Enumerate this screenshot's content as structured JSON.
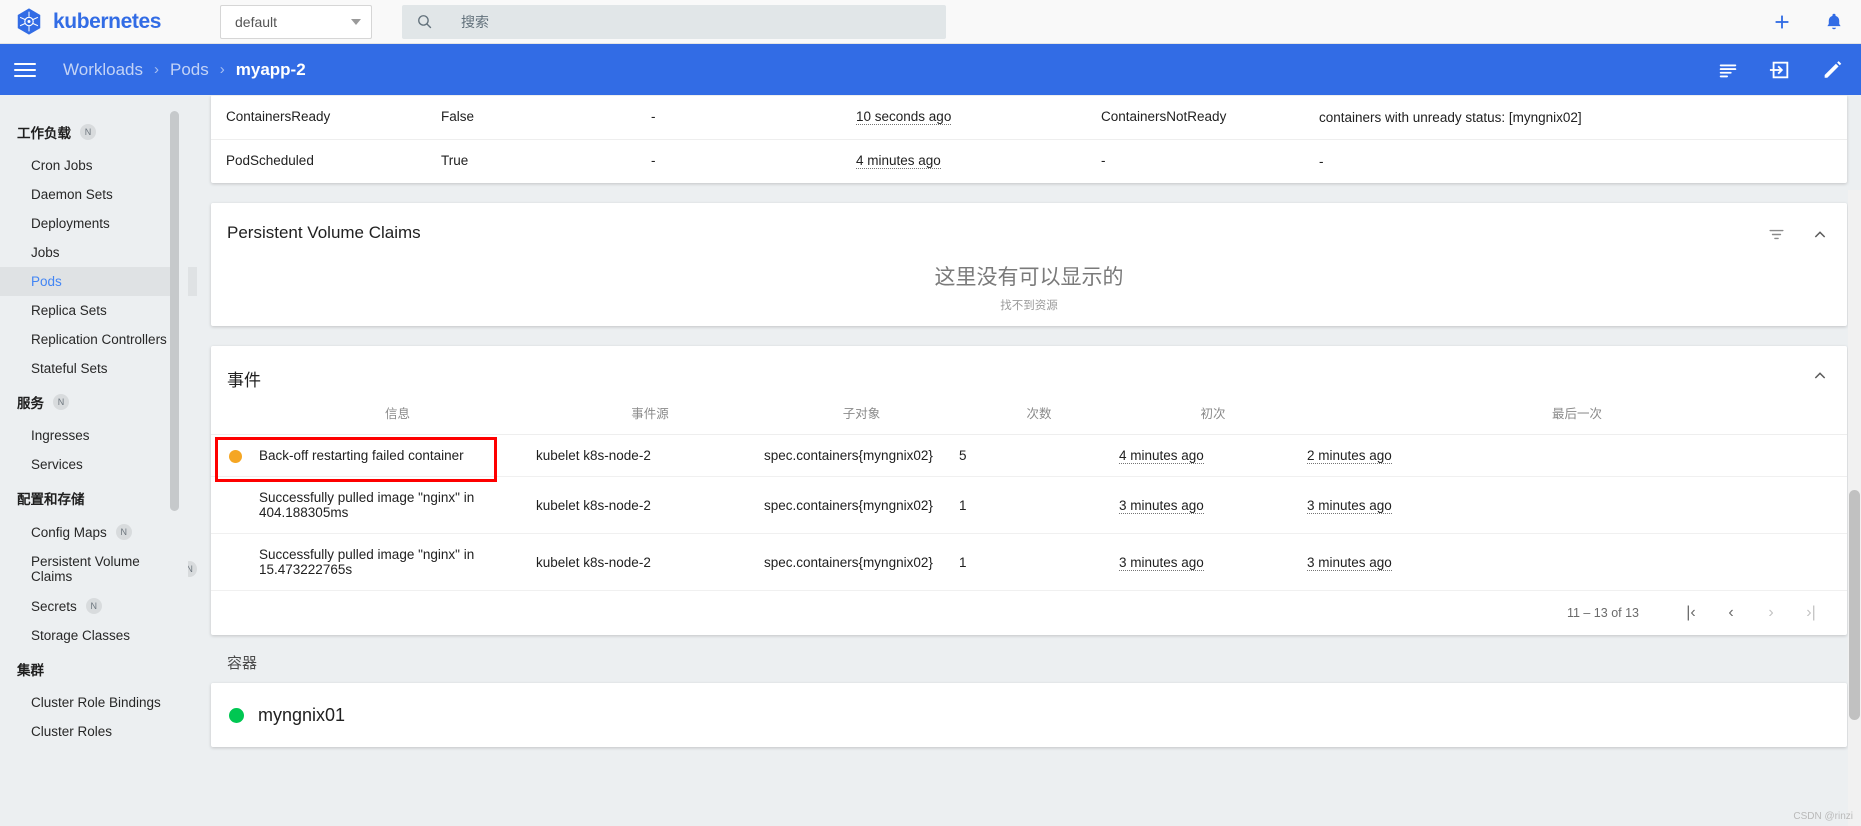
{
  "header": {
    "product_name": "kubernetes",
    "namespace_value": "default",
    "namespace_caret": "chevron-down-icon",
    "search_placeholder": "搜索",
    "add_label": "+",
    "icons": {
      "search": "search-icon",
      "add": "plus-icon",
      "notifications": "bell-icon"
    }
  },
  "breadcrumb": {
    "menu_icon": "hamburger-menu-icon",
    "items": [
      {
        "label": "Workloads",
        "active": false
      },
      {
        "label": "Pods",
        "active": false
      },
      {
        "label": "myapp-2",
        "active": true
      }
    ],
    "separator": "›",
    "actions": {
      "logs": "logs-icon",
      "exec": "exec-terminal-icon",
      "edit": "edit-pencil-icon"
    }
  },
  "sidebar": {
    "groups": [
      {
        "label": "工作负载",
        "badge": "N",
        "items": [
          {
            "label": "Cron Jobs",
            "selected": false,
            "badge": ""
          },
          {
            "label": "Daemon Sets",
            "selected": false,
            "badge": ""
          },
          {
            "label": "Deployments",
            "selected": false,
            "badge": ""
          },
          {
            "label": "Jobs",
            "selected": false,
            "badge": ""
          },
          {
            "label": "Pods",
            "selected": true,
            "badge": ""
          },
          {
            "label": "Replica Sets",
            "selected": false,
            "badge": ""
          },
          {
            "label": "Replication Controllers",
            "selected": false,
            "badge": ""
          },
          {
            "label": "Stateful Sets",
            "selected": false,
            "badge": ""
          }
        ]
      },
      {
        "label": "服务",
        "badge": "N",
        "items": [
          {
            "label": "Ingresses",
            "selected": false,
            "badge": ""
          },
          {
            "label": "Services",
            "selected": false,
            "badge": ""
          }
        ]
      },
      {
        "label": "配置和存储",
        "badge": "",
        "items": [
          {
            "label": "Config Maps",
            "selected": false,
            "badge": "N"
          },
          {
            "label": "Persistent Volume Claims",
            "selected": false,
            "badge": "N"
          },
          {
            "label": "Secrets",
            "selected": false,
            "badge": "N"
          },
          {
            "label": "Storage Classes",
            "selected": false,
            "badge": ""
          }
        ]
      },
      {
        "label": "集群",
        "badge": "",
        "items": [
          {
            "label": "Cluster Role Bindings",
            "selected": false,
            "badge": ""
          },
          {
            "label": "Cluster Roles",
            "selected": false,
            "badge": ""
          }
        ]
      }
    ]
  },
  "conditions": {
    "rows": [
      {
        "type": "ContainersReady",
        "status": "False",
        "last_probe": "-",
        "last_transition": "10 seconds ago",
        "reason": "ContainersNotReady",
        "message": "containers with unready status: [myngnix02]"
      },
      {
        "type": "PodScheduled",
        "status": "True",
        "last_probe": "-",
        "last_transition": "4 minutes ago",
        "reason": "-",
        "message": "-"
      }
    ],
    "clipped_above": "[myngnix02]"
  },
  "pvc": {
    "title": "Persistent Volume Claims",
    "filter_icon": "filter-icon",
    "collapse_icon": "chevron-up-icon",
    "empty_title": "这里没有可以显示的",
    "empty_subtitle": "找不到资源"
  },
  "events": {
    "title": "事件",
    "collapse_icon": "chevron-up-icon",
    "columns": [
      "信息",
      "事件源",
      "子对象",
      "次数",
      "初次",
      "最后一次"
    ],
    "rows": [
      {
        "status_dot": "#f5a623",
        "message": "Back-off restarting failed container",
        "source": "kubelet k8s-node-2",
        "subobject": "spec.containers{myngnix02}",
        "count": "5",
        "first_seen": "4 minutes ago",
        "last_seen": "2 minutes ago",
        "highlighted": true
      },
      {
        "status_dot": "",
        "message": "Successfully pulled image \"nginx\" in 404.188305ms",
        "source": "kubelet k8s-node-2",
        "subobject": "spec.containers{myngnix02}",
        "count": "1",
        "first_seen": "3 minutes ago",
        "last_seen": "3 minutes ago",
        "highlighted": false
      },
      {
        "status_dot": "",
        "message": "Successfully pulled image \"nginx\" in 15.473222765s",
        "source": "kubelet k8s-node-2",
        "subobject": "spec.containers{myngnix02}",
        "count": "1",
        "first_seen": "3 minutes ago",
        "last_seen": "3 minutes ago",
        "highlighted": false
      }
    ],
    "pagination": {
      "range_label": "11 – 13 of 13",
      "first": "|‹",
      "prev": "‹",
      "next": "›",
      "last": "›|"
    }
  },
  "containers": {
    "title": "容器",
    "items": [
      {
        "name": "myngnix01",
        "status_color": "#00c752"
      }
    ]
  },
  "watermark": "CSDN @rinzi",
  "colors": {
    "brand_blue": "#326ce5",
    "accent_blue": "#4285f4",
    "warning_orange": "#f5a623",
    "success_green": "#00c752",
    "highlight_red": "#fe0000",
    "page_bg": "#eceff1"
  }
}
